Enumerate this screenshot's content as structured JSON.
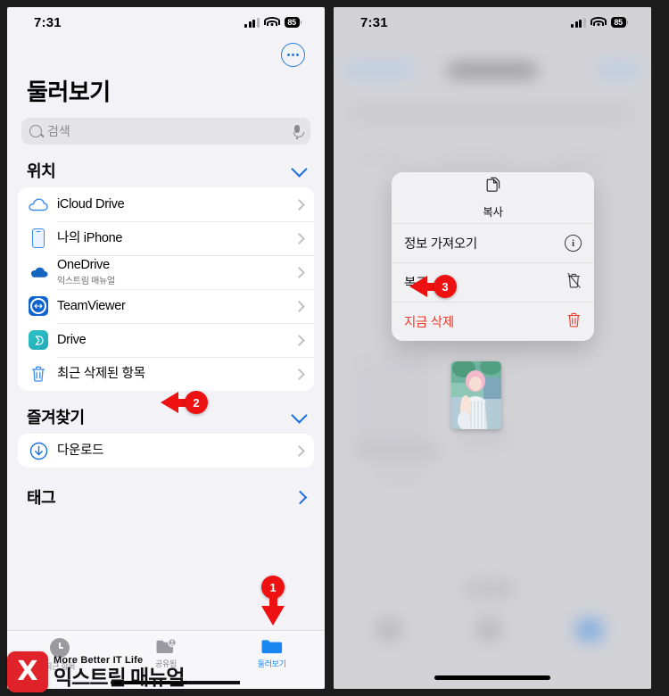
{
  "left_phone": {
    "status_bar": {
      "time": "7:31",
      "battery": "85",
      "signal_icon": "cellular-signal-icon",
      "wifi_icon": "wifi-icon",
      "battery_icon": "battery-icon"
    },
    "more_button_icon": "ellipsis-circle-icon",
    "page_title": "둘러보기",
    "search": {
      "placeholder": "검색",
      "search_icon": "search-icon",
      "mic_icon": "microphone-icon"
    },
    "sections": [
      {
        "title": "위치",
        "chevron_icon": "chevron-down-icon",
        "items": [
          {
            "label": "iCloud Drive",
            "sublabel": "",
            "icon": "icloud-drive-icon"
          },
          {
            "label": "나의 iPhone",
            "sublabel": "",
            "icon": "iphone-icon"
          },
          {
            "label": "OneDrive",
            "sublabel": "익스트림 매뉴얼",
            "icon": "onedrive-icon"
          },
          {
            "label": "TeamViewer",
            "sublabel": "",
            "icon": "teamviewer-icon"
          },
          {
            "label": "Drive",
            "sublabel": "",
            "icon": "drive-icon"
          },
          {
            "label": "최근 삭제된 항목",
            "sublabel": "",
            "icon": "trash-icon"
          }
        ]
      },
      {
        "title": "즐겨찾기",
        "chevron_icon": "chevron-down-icon",
        "items": [
          {
            "label": "다운로드",
            "sublabel": "",
            "icon": "download-circle-icon"
          }
        ]
      },
      {
        "title": "태그",
        "chevron_icon": "chevron-right-icon",
        "items": []
      }
    ],
    "tabs": [
      {
        "label": "최근 항목",
        "icon": "clock-icon",
        "active": false
      },
      {
        "label": "공유됨",
        "icon": "shared-folder-icon",
        "active": false
      },
      {
        "label": "둘러보기",
        "icon": "folder-icon",
        "active": true
      }
    ]
  },
  "right_phone": {
    "status_bar": {
      "time": "7:31",
      "battery": "85"
    },
    "context_menu": {
      "copy": {
        "label": "복사",
        "icon": "copy-icon"
      },
      "items": [
        {
          "label": "정보 가져오기",
          "icon": "info-circle-icon",
          "danger": false
        },
        {
          "label": "복구",
          "icon": "trash-restore-icon",
          "danger": false
        },
        {
          "label": "지금 삭제",
          "icon": "trash-icon",
          "danger": true
        }
      ]
    },
    "selected_thumbnail": "photo-thumbnail"
  },
  "callouts": [
    {
      "number": "1",
      "target": "둘러보기 탭",
      "direction": "down"
    },
    {
      "number": "2",
      "target": "최근 삭제된 항목",
      "direction": "left"
    },
    {
      "number": "3",
      "target": "복구",
      "direction": "left"
    }
  ],
  "watermark": {
    "logo": "X",
    "tagline": "More Better IT Life",
    "name": "익스트림 매뉴얼"
  },
  "colors": {
    "accent": "#1a86f0",
    "marker": "#ee1111",
    "danger": "#ef3b2d",
    "background": "#f2f2f7"
  }
}
